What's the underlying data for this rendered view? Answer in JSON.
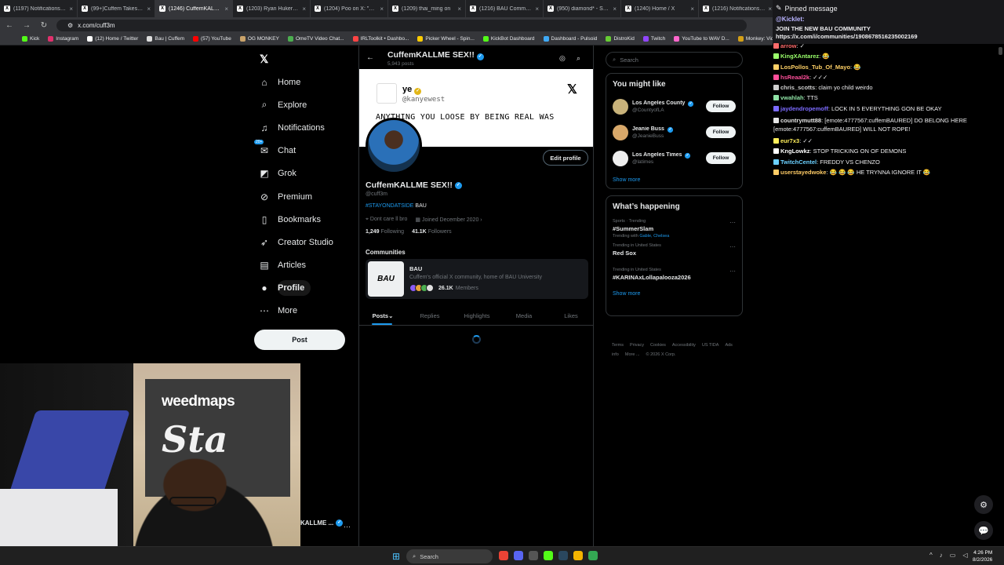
{
  "browser": {
    "tabs": [
      {
        "title": "(1197) Notifications / X",
        "active": false
      },
      {
        "title": "(99+)Cuffem Takes Bre",
        "active": false
      },
      {
        "title": "(1246) CuffemKALLME",
        "active": true
      },
      {
        "title": "(1203) Ryan Hukery on",
        "active": false
      },
      {
        "title": "(1204) Poo on X: \"http:",
        "active": false
      },
      {
        "title": "(1209) thai_ming on",
        "active": false
      },
      {
        "title": "(1216) BAU Communit",
        "active": false
      },
      {
        "title": "(950) diamond* - STFU",
        "active": false
      },
      {
        "title": "(1240) Home / X",
        "active": false
      },
      {
        "title": "(1216) Notifications / X",
        "active": false
      }
    ],
    "url": "x.com/cuff3m",
    "bookmarks": [
      {
        "label": "Kick",
        "color": "#53fc18"
      },
      {
        "label": "Instagram",
        "color": "#e1306c"
      },
      {
        "label": "(12) Home / Twitter",
        "color": "#ffffff"
      },
      {
        "label": "Bau | Cuffem",
        "color": "#dddddd"
      },
      {
        "label": "(57) YouTube",
        "color": "#ff0000"
      },
      {
        "label": "OG MONKEY",
        "color": "#c9a36a"
      },
      {
        "label": "OmeTV Video Chat...",
        "color": "#4caf50"
      },
      {
        "label": "IRLToolkit • Dashbo...",
        "color": "#ff4444"
      },
      {
        "label": "Picker Wheel - Spin...",
        "color": "#ffcc00"
      },
      {
        "label": "KickBot Dashboard",
        "color": "#53fc18"
      },
      {
        "label": "Dashboard - Pulsoid",
        "color": "#3fa9f5"
      },
      {
        "label": "DistroKid",
        "color": "#66cc33"
      },
      {
        "label": "Twitch",
        "color": "#9146ff"
      },
      {
        "label": "YouTube to WAV D...",
        "color": "#ff66cc"
      },
      {
        "label": "Monkey: Video Chat...",
        "color": "#d4a017"
      },
      {
        "label": "Home - Rob",
        "color": "#5865f2"
      }
    ]
  },
  "nav": {
    "items": [
      {
        "label": "Home",
        "icon": "home-icon",
        "glyph": "⌂"
      },
      {
        "label": "Explore",
        "icon": "search-icon",
        "glyph": "⌕"
      },
      {
        "label": "Notifications",
        "icon": "bell-icon",
        "glyph": "♫"
      },
      {
        "label": "Chat",
        "icon": "chat-icon",
        "glyph": "✉"
      },
      {
        "label": "Grok",
        "icon": "grok-icon",
        "glyph": "◩"
      },
      {
        "label": "Premium",
        "icon": "premium-icon",
        "glyph": "⊘"
      },
      {
        "label": "Bookmarks",
        "icon": "bookmark-icon",
        "glyph": "▯"
      },
      {
        "label": "Creator Studio",
        "icon": "rocket-icon",
        "glyph": "➶"
      },
      {
        "label": "Articles",
        "icon": "article-icon",
        "glyph": "▤"
      },
      {
        "label": "Profile",
        "icon": "profile-icon",
        "glyph": "●"
      },
      {
        "label": "More",
        "icon": "more-icon",
        "glyph": "⋯"
      }
    ],
    "chat_badge": "20+",
    "post_label": "Post",
    "account_name": "KALLME ..."
  },
  "profile": {
    "header_name": "CuffemKALLME SEX!!",
    "post_count": "5,943 posts",
    "banner": {
      "name": "ye",
      "handle": "@kanyewest",
      "text": "ANYTHING YOU LOOSE BY BEING REAL WAS"
    },
    "edit_label": "Edit profile",
    "name": "CuffemKALLME SEX!!",
    "handle": "@cuff3m",
    "bio_tag": "#STAYONDATSIDE",
    "bio_rest": " BAU",
    "location": "Dont care ll bro",
    "joined": "Joined December 2020",
    "following_count": "1,249",
    "following_label": "Following",
    "followers_count": "41.1K",
    "followers_label": "Followers",
    "communities_title": "Communities",
    "community": {
      "name": "BAU",
      "description": "Cuffem's official X community, home of BAU University",
      "members_count": "26.1K",
      "members_label": "Members"
    },
    "tabs": [
      "Posts",
      "Replies",
      "Highlights",
      "Media",
      "Likes"
    ]
  },
  "right": {
    "search_placeholder": "Search",
    "who_title": "You might like",
    "who": [
      {
        "name": "Los Angeles County",
        "handle": "@CountyofLA",
        "color": "#c8b27a"
      },
      {
        "name": "Jeanie Buss",
        "handle": "@JeanieBuss",
        "color": "#d8a86a"
      },
      {
        "name": "Los Angeles Times",
        "handle": "@latimes",
        "color": "#eeeeee"
      }
    ],
    "follow_label": "Follow",
    "show_more": "Show more",
    "happening_title": "What’s happening",
    "trends": [
      {
        "context": "Sports · Trending",
        "name": "#SummerSlam",
        "sub_prefix": "Trending with ",
        "sub_links": "Gable, Chelsea"
      },
      {
        "context": "Trending in United States",
        "name": "Red Sox",
        "sub_prefix": "",
        "sub_links": ""
      },
      {
        "context": "Trending in United States",
        "name": "#KARINAxLollapalooza2026",
        "sub_prefix": "",
        "sub_links": ""
      }
    ],
    "footer": [
      "Terms",
      "Privacy",
      "Cookies",
      "Accessibility",
      "US TIDA",
      "Ads info",
      "More ...",
      "© 2026 X Corp."
    ]
  },
  "chat": {
    "pinned_label": "Pinned message",
    "pinned_user": "@Kicklet:",
    "pinned_text": "JOIN THE NEW BAU COMMUNITY https://x.com/i/communities/1908678516235002169",
    "messages": [
      {
        "user": "arrow",
        "color": "#ff6b6b",
        "text": "✓"
      },
      {
        "user": "KingXAntarez",
        "color": "#9aff6b",
        "text": "😂"
      },
      {
        "user": "LosPollos_Tub_Of_Mayo",
        "color": "#ffd166",
        "text": "😂"
      },
      {
        "user": "hsReaal2k",
        "color": "#ff4f9a",
        "text": "✓✓✓"
      },
      {
        "user": "chris_scotts",
        "color": "#cfcfcf",
        "text": "claim yo child weirdo"
      },
      {
        "user": "vwahlah",
        "color": "#8fe3a5",
        "text": "TTS"
      },
      {
        "user": "jaydendropemoff",
        "color": "#7c6bff",
        "text": "LOCK IN 5 EVERYTHING GON BE OKAY"
      },
      {
        "user": "countrymutt88",
        "color": "#e6e6e6",
        "text": "[emote:4777567:cuffemBAURED] DO BELONG HERE [emote:4777567:cuffemBAURED] WILL NOT ROPE!"
      },
      {
        "user": "eur7x3",
        "color": "#ffef5b",
        "text": "✓✓"
      },
      {
        "user": "KngLowkz",
        "color": "#ffffff",
        "text": "STOP TRICKING ON OF DEMONS"
      },
      {
        "user": "TwitchCentel",
        "color": "#6bd0ff",
        "text": "FREDDY VS CHENZO"
      },
      {
        "user": "userstayedwoke",
        "color": "#ffcc66",
        "text": "😂 😂 😂 HE TRYNNA IGNORE IT 😂"
      }
    ]
  },
  "webcam": {
    "sign_line1": "weedmaps",
    "sign_line2": "Sta"
  },
  "taskbar": {
    "search_label": "Search",
    "time": "4:26 PM",
    "date": "8/2/2026"
  }
}
